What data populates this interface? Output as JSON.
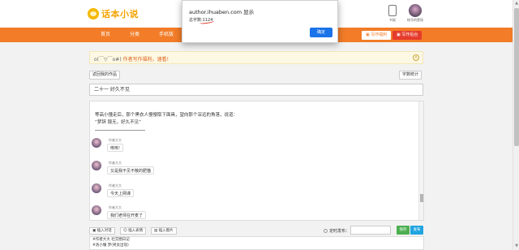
{
  "header": {
    "logo_text": "话本小说",
    "phone_label": "书架",
    "user_label": "帐号的楚瑶"
  },
  "nav": {
    "items": [
      "首页",
      "分类",
      "手机版"
    ],
    "welfare_button": "写作福利",
    "backend_button": "写作后台"
  },
  "notice": {
    "emoticon": "o(￣▽￣o#)",
    "text": "作者写作福利，速看!"
  },
  "toolbar_top": {
    "back_button": "返回我的作品",
    "stats_button": "字数统计"
  },
  "editor": {
    "chapter_title": "二十一 好久不见",
    "paragraph_1": "等高小懂走后，那个黑衣人慢慢取下面具，望向那个深远的角落，说道：",
    "paragraph_2": "“梦辞 锻无，好久不见”",
    "chat": [
      {
        "name": "作者大大",
        "text": "咳咳!"
      },
      {
        "name": "作者大大",
        "text": "又是我不见不散的肥猫"
      },
      {
        "name": "作者大大",
        "text": "今天上网课"
      },
      {
        "name": "作者大大",
        "text": "我们老师在开麦了"
      }
    ]
  },
  "toolbar_bottom": {
    "insert_dialog": "插入对话",
    "insert_emoji": "插入表情",
    "insert_image": "插入图片",
    "schedule_label": "定时发布：",
    "save_button": "保存",
    "publish_button": "发布"
  },
  "tags": {
    "line_1": "#作者大大 社交圈日记",
    "line_2": "#洛小懂 梦(男女出现)"
  },
  "dialog": {
    "title": "author.ihuaben.com 显示",
    "message": "总字数:1124",
    "ok_button": "确定"
  }
}
